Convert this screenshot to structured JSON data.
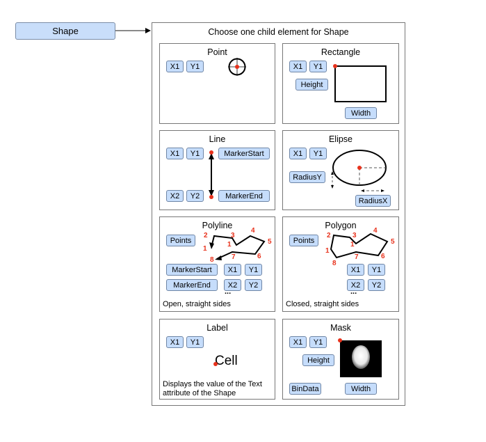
{
  "source_node": {
    "label": "Shape"
  },
  "container": {
    "title": "Choose one child element for Shape"
  },
  "colors": {
    "chip_fill": "#c6ddfb",
    "chip_border": "#6f86a6",
    "marker": "#e8321c",
    "border": "#777777"
  },
  "panels": {
    "point": {
      "title": "Point",
      "chips": [
        "X1",
        "Y1"
      ]
    },
    "rectangle": {
      "title": "Rectangle",
      "chips": [
        "X1",
        "Y1",
        "Height",
        "Width"
      ]
    },
    "line": {
      "title": "Line",
      "chips": [
        "X1",
        "Y1",
        "MarkerStart",
        "X2",
        "Y2",
        "MarkerEnd"
      ]
    },
    "ellipse": {
      "title": "Elipse",
      "chips": [
        "X1",
        "Y1",
        "RadiusY",
        "RadiusX"
      ]
    },
    "polyline": {
      "title": "Polyline",
      "chips": [
        "Points",
        "MarkerStart",
        "X1",
        "Y1",
        "MarkerEnd",
        "X2",
        "Y2"
      ],
      "ellipsis": "...",
      "vertex_labels": [
        "1",
        "2",
        "3",
        "1",
        "4",
        "5",
        "6",
        "7",
        "8"
      ],
      "note": "Open, straight sides"
    },
    "polygon": {
      "title": "Polygon",
      "chips": [
        "Points",
        "X1",
        "Y1",
        "X2",
        "Y2"
      ],
      "ellipsis": "...",
      "vertex_labels": [
        "1",
        "2",
        "3",
        "1",
        "4",
        "5",
        "6",
        "7",
        "8"
      ],
      "note": "Closed, straight sides"
    },
    "label": {
      "title": "Label",
      "chips": [
        "X1",
        "Y1"
      ],
      "sample_text": "Cell",
      "note_line1": "Displays the value of the Text",
      "note_line2": "attribute of the Shape"
    },
    "mask": {
      "title": "Mask",
      "chips": [
        "X1",
        "Y1",
        "Height",
        "BinData",
        "Width"
      ]
    }
  }
}
